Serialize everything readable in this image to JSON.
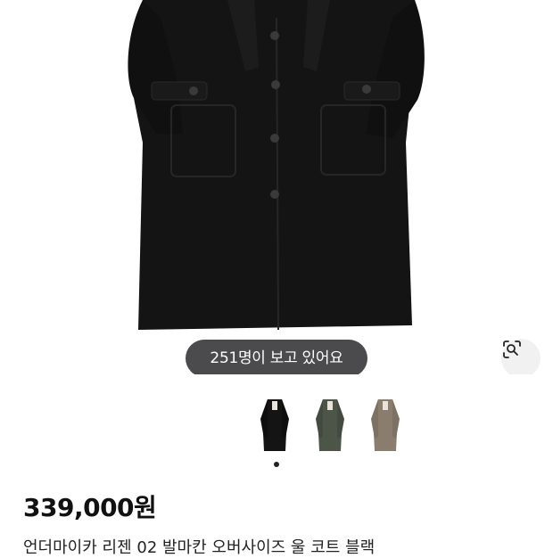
{
  "product": {
    "image_alt_icon": "coat-photo",
    "viewers_label": "251명이 보고 있어요",
    "price": "339,000원",
    "title": "언더마이카 리젠 02 발마칸 오버사이즈 울 코트 블랙"
  },
  "thumbnails": [
    {
      "color_name": "black",
      "swatch": "#141414",
      "selected": true
    },
    {
      "color_name": "khaki",
      "swatch": "#4d5448",
      "selected": false
    },
    {
      "color_name": "beige",
      "swatch": "#8a7d6e",
      "selected": false
    }
  ],
  "icons": {
    "lens": "visual-search-icon"
  },
  "colors": {
    "pill_bg": "#3c3c3e",
    "coat": "#141414"
  }
}
